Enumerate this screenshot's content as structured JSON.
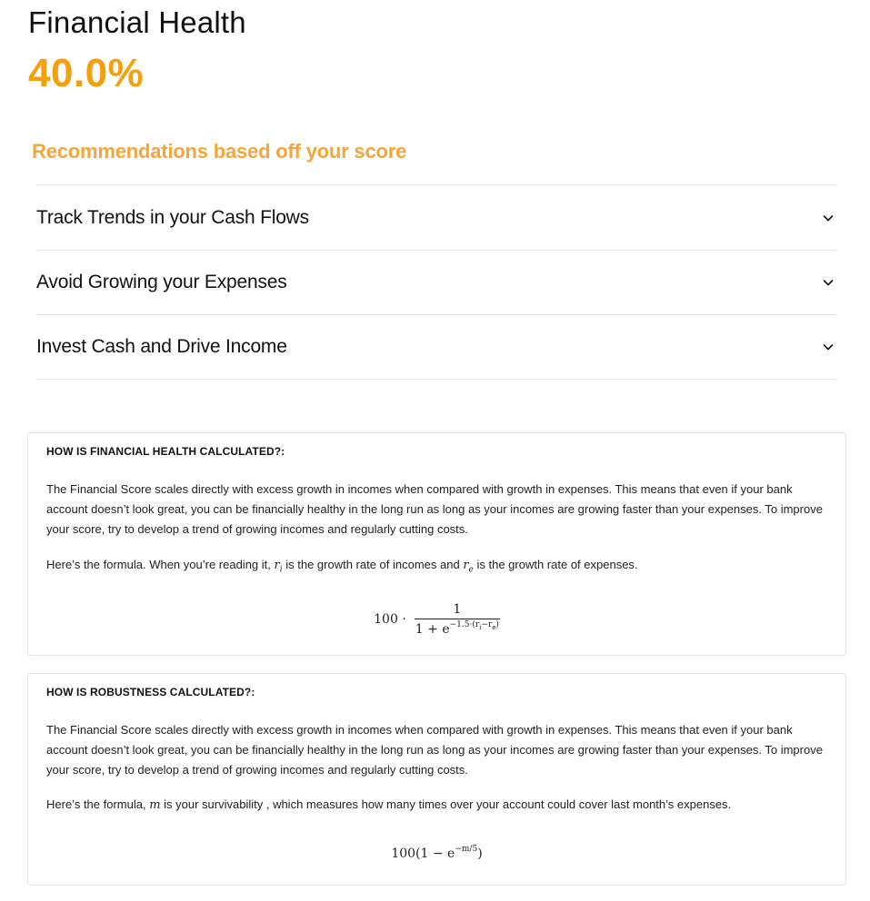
{
  "header": {
    "title": "Financial Health",
    "score": "40.0%"
  },
  "recommendations": {
    "heading": "Recommendations based off your score",
    "items": [
      {
        "label": "Track Trends in your Cash Flows"
      },
      {
        "label": "Avoid Growing your Expenses"
      },
      {
        "label": "Invest Cash and Drive Income"
      }
    ]
  },
  "cards": [
    {
      "title": "HOW IS FINANCIAL HEALTH CALCULATED?:",
      "body": "The Financial Score scales directly with excess growth in incomes when compared with growth in expenses. This means that even if your bank account doesn’t look great, you can be financially healthy in the long run as long as your incomes are growing faster than your expenses. To improve your score, try to develop a trend of growing incomes and regularly cutting costs.",
      "formula_intro_a": "Here’s the formula. When you’re reading it, ",
      "var_1": "r",
      "var_1_sub": "i",
      "formula_intro_b": " is the growth rate of incomes and ",
      "var_2": "r",
      "var_2_sub": "e",
      "formula_intro_c": " is the growth rate of expenses.",
      "formula": {
        "coef": "100 ·",
        "numerator": "1",
        "denominator_base": "1 + e",
        "denominator_exp": "−1.5·(r",
        "exp_sub_1": "i",
        "exp_mid": "−r",
        "exp_sub_2": "e",
        "exp_end": ")"
      }
    },
    {
      "title": "HOW IS ROBUSTNESS CALCULATED?:",
      "body": "The Financial Score scales directly with excess growth in incomes when compared with growth in expenses. This means that even if your bank account doesn’t look great, you can be financially healthy in the long run as long as your incomes are growing faster than your expenses. To improve your score, try to develop a trend of growing incomes and regularly cutting costs.",
      "formula_intro_a": "Here’s the formula, ",
      "var_1": "m",
      "formula_intro_b": " is your survivability , which measures how many times over your account could cover last month’s expenses.",
      "formula": {
        "base": "100(1 − e",
        "exp": "−m/5",
        "end": ")"
      }
    }
  ],
  "icons": {
    "accordion_toggle": "chevron-down-icon"
  },
  "colors": {
    "accent": "#f59f0a",
    "accent_light": "#f5a63a",
    "text": "#111111",
    "divider": "#e6e6e6"
  }
}
